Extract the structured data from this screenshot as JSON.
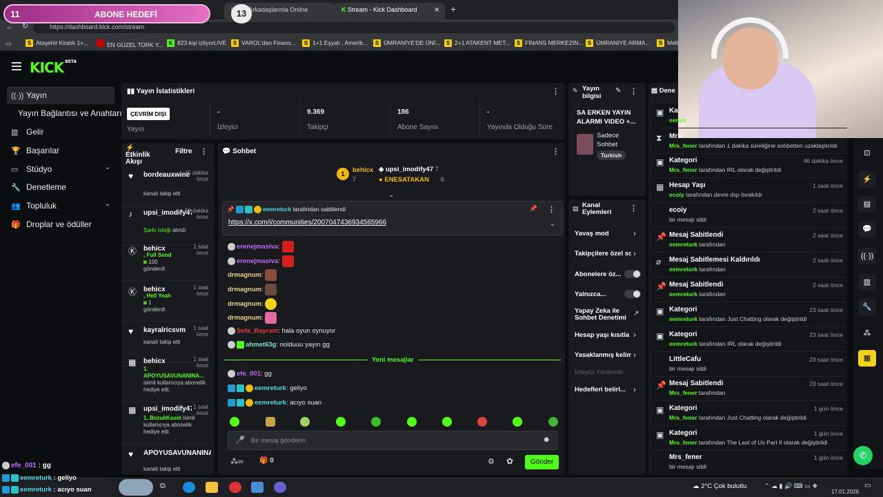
{
  "overlay": {
    "abone_left": "11",
    "abone_label": "ABONE HEDEFİ",
    "abone_right": "13"
  },
  "browser": {
    "tabs": [
      {
        "label": "ildim | Arkadaşlarınla Online"
      },
      {
        "label": "Stream - Kick Dashboard"
      }
    ],
    "url": "https://dashboard.kick.com/stream",
    "bookmarks": [
      "Ataşehir Kiralık 1+...",
      "EN GÜZEL TÜRK Y...",
      "823 kişi izliyorLIVE",
      "VAROL'dan Finans...",
      "1+1 Eşyalı , Amerik...",
      "ÜMRANİYE'DE ÜNİ...",
      "2+1 ATAKENT MET...",
      "FİNANS MERKEZİN...",
      "ÜMRANİYE ARMA...",
      "Melt"
    ]
  },
  "sidebar": {
    "items": [
      {
        "label": "Yayın"
      },
      {
        "label": "Yayın Bağlantısı ve Anahtarı"
      },
      {
        "label": "Gelir"
      },
      {
        "label": "Başarılar"
      },
      {
        "label": "Stüdyo"
      },
      {
        "label": "Denetleme"
      },
      {
        "label": "Topluluk"
      },
      {
        "label": "Droplar ve ödüller"
      }
    ]
  },
  "stats": {
    "title": "Yayın İstatistikleri",
    "status": "ÇEVRİM DIŞI",
    "status_label": "Yayın",
    "items": [
      {
        "value": "-",
        "label": "İzleyici"
      },
      {
        "value": "9.369",
        "label": "Takipçi"
      },
      {
        "value": "186",
        "label": "Abone Sayısı"
      },
      {
        "value": "-",
        "label": "Yayında Olduğu Süre"
      }
    ]
  },
  "activity": {
    "title": "Etkinlik Akışı",
    "filter": "Filtre",
    "events": [
      {
        "name": "bordeauxwine",
        "time": "45 dakika önce",
        "desc": "kanalı takip etti"
      },
      {
        "name": "upsi_imodify47",
        "time": "50 dakika önce",
        "desc_hl": "Şarkı isteği",
        "desc": "alındı"
      },
      {
        "name": "behicx",
        "time": "1 saat önce",
        "desc_hl": ", Full Send",
        "amount": "100",
        "desc": "gönderdi"
      },
      {
        "name": "behicx",
        "time": "1 saat önce",
        "desc_hl": ", Hell Yeah",
        "amount": "1",
        "desc": "gönderdi"
      },
      {
        "name": "kayralricsvm",
        "time": "1 saat önce",
        "desc": "kanalı takip etti"
      },
      {
        "name": "behicx",
        "time": "1 saat önce",
        "desc_hl": "1. APOYUSAVUNANINA...",
        "desc": "isimli kullanıcıya abonelik hediye etti."
      },
      {
        "name": "upsi_imodify47",
        "time": "1 saat önce",
        "desc_hl": "1, BozukKaset",
        "desc": "isimli kullanıcıya abonelik hediye etti."
      },
      {
        "name": "APOYUSAVUNANINA",
        "time": "",
        "desc": "kanalı takip etti"
      }
    ]
  },
  "chat": {
    "title": "Sohbet",
    "leaders": [
      {
        "name": "behicx",
        "count": "7"
      },
      {
        "name": "upsi_imodify47",
        "count": "7"
      },
      {
        "name": "ENESATAKAN",
        "count": "6"
      }
    ],
    "pinned_user": "eemreturk",
    "pinned_suffix": "tarafından sabitlendi",
    "pinned_link": "https://x.com/i/communities/2007047436934565966",
    "messages": [
      {
        "user": "erenejmasiva",
        "text": ""
      },
      {
        "user": "erenejmasiva",
        "text": ""
      },
      {
        "user": "drmagnum",
        "text": ""
      },
      {
        "user": "drmagnum",
        "text": ""
      },
      {
        "user": "drmagnum",
        "text": ""
      },
      {
        "user": "drmagnum",
        "text": ""
      },
      {
        "user": "Sefa_Bayram",
        "text": "hala oyun oynuyor"
      },
      {
        "user": "ahmet63g",
        "text": "nolduuu yayın gg"
      }
    ],
    "new_messages": "Yeni mesajlar",
    "new": [
      {
        "user": "efe_001",
        "text": "gg"
      },
      {
        "user": "eemreturk",
        "text": "geliyo"
      },
      {
        "user": "eemreturk",
        "text": "acıyo suan"
      }
    ],
    "input_placeholder": "Bir mesaj gönderin",
    "points": "0",
    "send": "Gönder"
  },
  "info": {
    "title": "Yayın bilgisi",
    "stream_title": "SA ERKEN YAYIN ALARMI VIDEO +...",
    "category": "Sadece Sohbet",
    "language": "Turkish"
  },
  "actions": {
    "title": "Kanal Eylemleri",
    "items": [
      {
        "label": "Yavaş mod"
      },
      {
        "label": "Takipçilere özel so"
      },
      {
        "label": "Abonelere öz..."
      },
      {
        "label": "Yalnızca..."
      },
      {
        "label": "Yapay Zeka ile Sohbet Denetimi"
      },
      {
        "label": "Hesap yaşı kısıtla"
      },
      {
        "label": "Yasaklanmış kelim"
      },
      {
        "label": "İzleyici Yönlendir"
      },
      {
        "label": "Hedefleri belirl..."
      }
    ]
  },
  "modlog": {
    "title": "Dene",
    "items": [
      {
        "h": "Ka",
        "u": "eemre",
        "s": "",
        "t": ""
      },
      {
        "h": "Mrs",
        "u": "Mrs_fener",
        "s": "tarafından 1 dakika süreliğine sohbetten uzaklaştırıldı",
        "t": ""
      },
      {
        "h": "Kategori",
        "u": "Mrs_fener",
        "s": "tarafından IRL olarak değiştirildi",
        "t": "46 dakika önce"
      },
      {
        "h": "Hesap Yaşı",
        "u": "ecoiy",
        "s": "tarafından devre dışı bırakıldı",
        "t": "1 saat önce"
      },
      {
        "h": "ecoiy",
        "u": "",
        "s": "bir mesajı sildi",
        "t": "2 saat önce"
      },
      {
        "h": "Mesaj Sabitlendi",
        "u": "eemreturk",
        "s": "tarafından",
        "t": "2 saat önce"
      },
      {
        "h": "Mesaj Sabitlemesi Kaldırıldı",
        "u": "eemreturk",
        "s": "tarafından",
        "t": "2 saat önce"
      },
      {
        "h": "Mesaj Sabitlendi",
        "u": "eemreturk",
        "s": "tarafından",
        "t": "2 saat önce"
      },
      {
        "h": "Kategori",
        "u": "eemreturk",
        "s": "tarafından Just Chatting olarak değiştirildi",
        "t": "23 saat önce"
      },
      {
        "h": "Kategori",
        "u": "eemreturk",
        "s": "tarafından IRL olarak değiştirildi",
        "t": "23 saat önce"
      },
      {
        "h": "LittleCafu",
        "u": "",
        "s": "bir mesajı sildi",
        "t": "23 saat önce"
      },
      {
        "h": "Mesaj Sabitlendi",
        "u": "Mrs_fener",
        "s": "tarafından",
        "t": "23 saat önce"
      },
      {
        "h": "Kategori",
        "u": "Mrs_fener",
        "s": "tarafından Just Chatting olarak değiştirildi",
        "t": "1 gün önce"
      },
      {
        "h": "Kategori",
        "u": "Mrs_fener",
        "s": "tarafından The Last of Us Part II olarak değiştirildi",
        "t": "1 gün önce"
      },
      {
        "h": "Mrs_fener",
        "u": "",
        "s": "bir mesajı sildi",
        "t": "1 gün önce"
      }
    ]
  },
  "overlay_chat": [
    {
      "user": "efe_001",
      "text": "gg"
    },
    {
      "user": "eemreturk",
      "text": "geliyo"
    },
    {
      "user": "eemreturk",
      "text": "acıyo suan"
    }
  ],
  "taskbar": {
    "weather": "2°C  Çok bulutlu",
    "date": "17.01.2026"
  }
}
